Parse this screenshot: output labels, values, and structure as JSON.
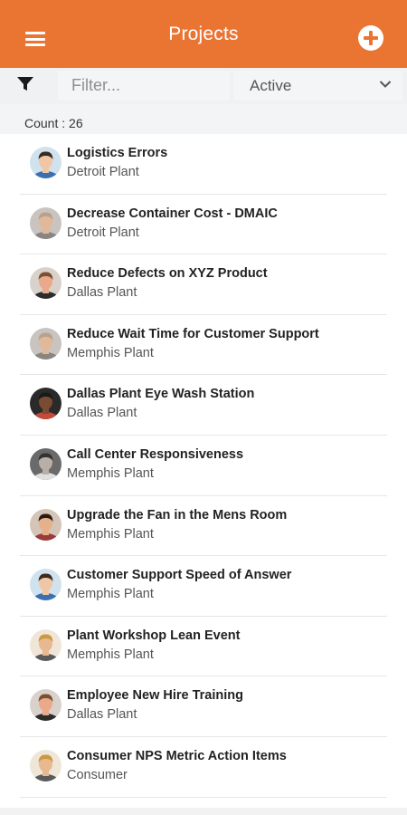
{
  "header": {
    "title": "Projects",
    "menu_icon": "hamburger-menu-icon",
    "add_icon": "add-circle-icon",
    "color": "#ea7533"
  },
  "filter": {
    "icon": "filter-funnel-icon",
    "placeholder": "Filter...",
    "value": "",
    "status_selected": "Active"
  },
  "count_label": "Count : 26",
  "projects": [
    {
      "title": "Logistics Errors",
      "plant": "Detroit Plant",
      "avatar": {
        "skin": "#f1c6a4",
        "hair": "#3b2a20",
        "bg": "#cfe2ee",
        "shirt": "#3b6fb0"
      }
    },
    {
      "title": "Decrease Container Cost - DMAIC",
      "plant": "Detroit Plant",
      "avatar": {
        "skin": "#e2b89b",
        "hair": "#b9a28b",
        "bg": "#c9c4bf",
        "shirt": "#8a8580"
      }
    },
    {
      "title": "Reduce Defects on XYZ Product",
      "plant": "Dallas Plant",
      "avatar": {
        "skin": "#e9a98a",
        "hair": "#7a5030",
        "bg": "#d9d2cc",
        "shirt": "#2c2c2c"
      }
    },
    {
      "title": "Reduce Wait Time for Customer Support",
      "plant": "Memphis Plant",
      "avatar": {
        "skin": "#e2b89b",
        "hair": "#b9a28b",
        "bg": "#c9c4bf",
        "shirt": "#8a8580"
      }
    },
    {
      "title": "Dallas Plant Eye Wash Station",
      "plant": "Dallas Plant",
      "avatar": {
        "skin": "#7a4a32",
        "hair": "#1a1a1a",
        "bg": "#2a2a2a",
        "shirt": "#c44a3a"
      }
    },
    {
      "title": "Call Center Responsiveness",
      "plant": "Memphis Plant",
      "avatar": {
        "skin": "#b8b0a8",
        "hair": "#333333",
        "bg": "#6a6a6a",
        "shirt": "#e0e0e0"
      }
    },
    {
      "title": "Upgrade the Fan in the Mens Room",
      "plant": "Memphis Plant",
      "avatar": {
        "skin": "#e6b08a",
        "hair": "#2a1a14",
        "bg": "#d4c5b8",
        "shirt": "#9a3b3b"
      }
    },
    {
      "title": "Customer Support Speed of Answer",
      "plant": "Memphis Plant",
      "avatar": {
        "skin": "#f1c6a4",
        "hair": "#3b2a20",
        "bg": "#cfe2ee",
        "shirt": "#3b6fb0"
      }
    },
    {
      "title": "Plant Workshop Lean Event",
      "plant": "Memphis Plant",
      "avatar": {
        "skin": "#e8b890",
        "hair": "#c99a40",
        "bg": "#f0e6d8",
        "shirt": "#5a5a5a"
      }
    },
    {
      "title": "Employee New Hire Training",
      "plant": "Dallas Plant",
      "avatar": {
        "skin": "#e9a98a",
        "hair": "#7a5030",
        "bg": "#d9d2cc",
        "shirt": "#2c2c2c"
      }
    },
    {
      "title": "Consumer NPS Metric Action Items",
      "plant": "Consumer",
      "avatar": {
        "skin": "#e8b890",
        "hair": "#c99a40",
        "bg": "#f0e6d8",
        "shirt": "#5a5a5a"
      }
    }
  ]
}
